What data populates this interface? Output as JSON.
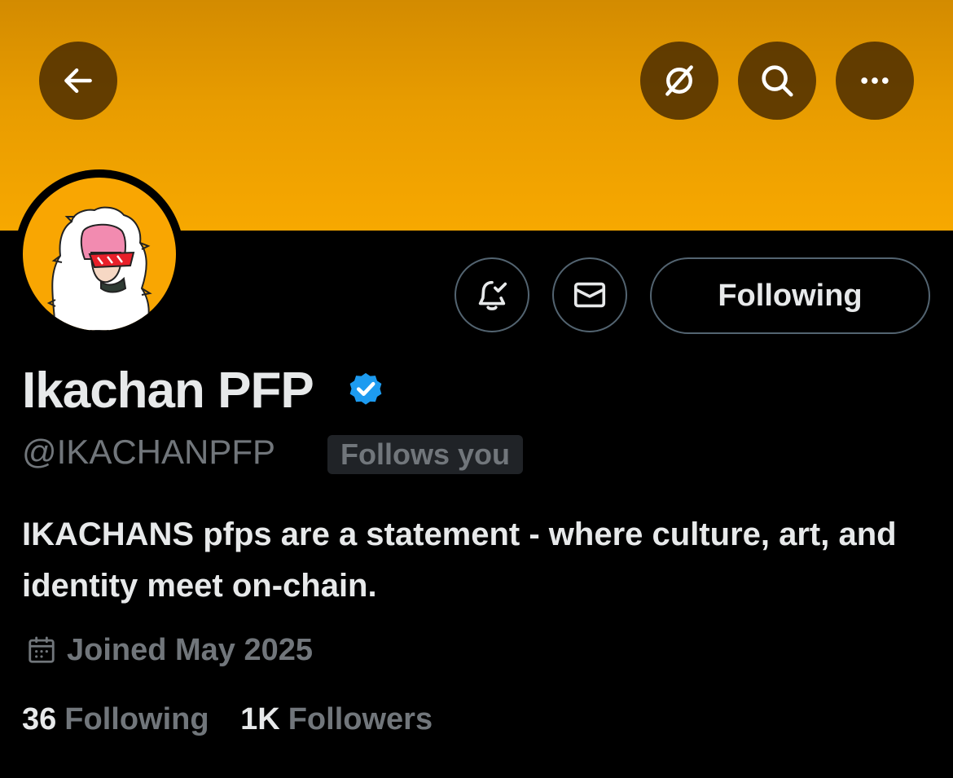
{
  "colors": {
    "banner_top": "#d38b00",
    "banner_bottom": "#f7a800",
    "background": "#000000",
    "text_primary": "#e7e9ea",
    "text_secondary": "#71767b",
    "verified_blue": "#1d9bf0",
    "border": "#536471"
  },
  "header": {
    "back_icon": "arrow-left-icon",
    "grok_icon": "grok-slash-icon",
    "search_icon": "search-icon",
    "more_icon": "more-horizontal-icon"
  },
  "profile": {
    "display_name": "Ikachan PFP",
    "verified": true,
    "handle": "@IKACHANPFP",
    "follows_you_label": "Follows you",
    "bio": "IKACHANS pfps are a statement - where culture, art, and identity meet on-chain.",
    "joined": "Joined May 2025",
    "following_count": "36",
    "following_label": "Following",
    "followers_count": "1K",
    "followers_label": "Followers"
  },
  "actions": {
    "notifications_icon": "bell-check-icon",
    "message_icon": "envelope-icon",
    "follow_button_label": "Following"
  }
}
